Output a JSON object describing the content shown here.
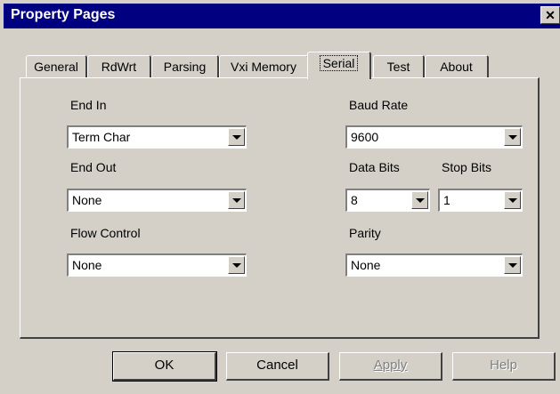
{
  "window": {
    "title": "Property Pages"
  },
  "tabs": [
    {
      "label": "General"
    },
    {
      "label": "RdWrt"
    },
    {
      "label": "Parsing"
    },
    {
      "label": "Vxi Memory"
    },
    {
      "label": "Serial"
    },
    {
      "label": "Test"
    },
    {
      "label": "About"
    }
  ],
  "active_tab": "Serial",
  "serial": {
    "end_in": {
      "label": "End In",
      "value": "Term Char"
    },
    "end_out": {
      "label": "End Out",
      "value": "None"
    },
    "flow_control": {
      "label": "Flow Control",
      "value": "None"
    },
    "baud_rate": {
      "label": "Baud Rate",
      "value": "9600"
    },
    "data_bits": {
      "label": "Data Bits",
      "value": "8"
    },
    "stop_bits": {
      "label": "Stop Bits",
      "value": "1"
    },
    "parity": {
      "label": "Parity",
      "value": "None"
    }
  },
  "buttons": {
    "ok": "OK",
    "cancel": "Cancel",
    "apply": "Apply",
    "help": "Help"
  },
  "icons": {
    "close": "close-icon",
    "dropdown": "chevron-down-icon"
  }
}
